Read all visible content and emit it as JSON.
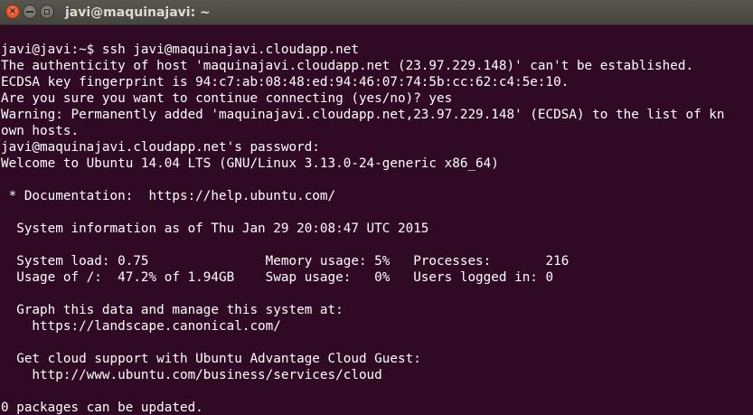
{
  "window": {
    "title": "javi@maquinajavi: ~",
    "buttons": {
      "close_icon": "×"
    }
  },
  "terminal": {
    "background": "#300a24",
    "foreground": "#ffffff",
    "lines": [
      "javi@javi:~$ ssh javi@maquinajavi.cloudapp.net",
      "The authenticity of host 'maquinajavi.cloudapp.net (23.97.229.148)' can't be established.",
      "ECDSA key fingerprint is 94:c7:ab:08:48:ed:94:46:07:74:5b:cc:62:c4:5e:10.",
      "Are you sure you want to continue connecting (yes/no)? yes",
      "Warning: Permanently added 'maquinajavi.cloudapp.net,23.97.229.148' (ECDSA) to the list of kn",
      "own hosts.",
      "javi@maquinajavi.cloudapp.net's password:",
      "Welcome to Ubuntu 14.04 LTS (GNU/Linux 3.13.0-24-generic x86_64)",
      "",
      " * Documentation:  https://help.ubuntu.com/",
      "",
      "  System information as of Thu Jan 29 20:08:47 UTC 2015",
      "",
      "  System load: 0.75               Memory usage: 5%   Processes:       216",
      "  Usage of /:  47.2% of 1.94GB    Swap usage:   0%   Users logged in: 0",
      "",
      "  Graph this data and manage this system at:",
      "    https://landscape.canonical.com/",
      "",
      "  Get cloud support with Ubuntu Advantage Cloud Guest:",
      "    http://www.ubuntu.com/business/services/cloud",
      "",
      "0 packages can be updated."
    ]
  }
}
